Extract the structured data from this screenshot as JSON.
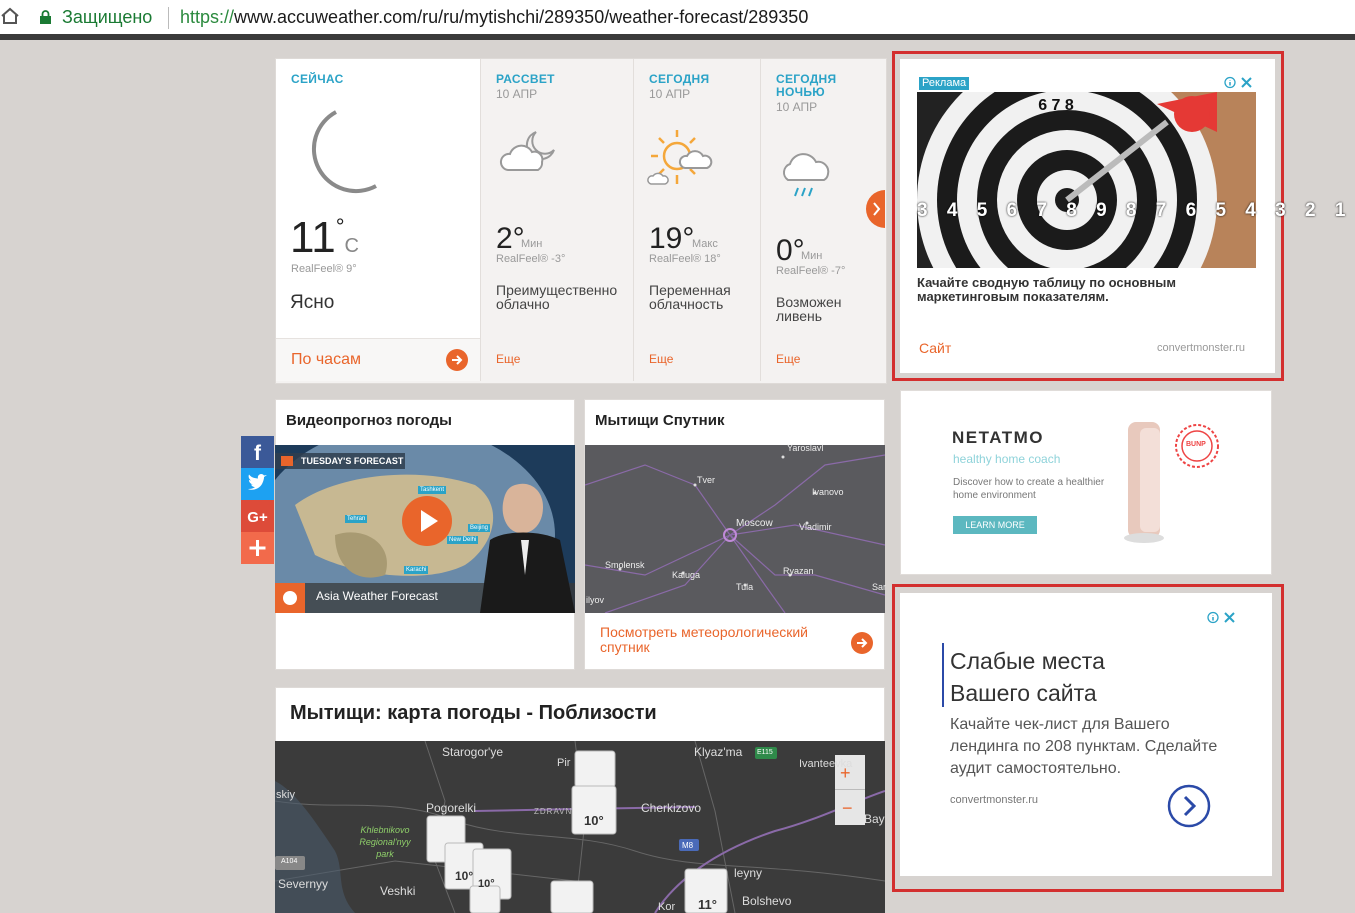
{
  "browser": {
    "secure_label": "Защищено",
    "url_scheme": "https://",
    "url_rest": "www.accuweather.com/ru/ru/mytishchi/289350/weather-forecast/289350"
  },
  "now": {
    "caption": "СЕЙЧАС",
    "temp": "11",
    "deg": "°",
    "unit": "C",
    "realfeel": "RealFeel® 9°",
    "condition": "Ясно",
    "hourly_link": "По часам",
    "icon": "moon-icon"
  },
  "forecasts": [
    {
      "caption": "РАССВЕТ",
      "date": "10 АПР",
      "temp": "2°",
      "tag": "Мин",
      "realfeel": "RealFeel® -3°",
      "condition": "Преимущественно облачно",
      "more": "Еще",
      "icon": "cloud-moon-icon"
    },
    {
      "caption": "СЕГОДНЯ",
      "date": "10 АПР",
      "temp": "19°",
      "tag": "Макс",
      "realfeel": "RealFeel® 18°",
      "condition": "Переменная облачность",
      "more": "Еще",
      "icon": "sun-cloud-icon"
    },
    {
      "caption": "СЕГОДНЯ НОЧЬЮ",
      "date": "10 АПР",
      "temp": "0°",
      "tag": "Мин",
      "realfeel": "RealFeel® -7°",
      "condition": "Возможен ливень",
      "more": "Еще",
      "icon": "rain-cloud-icon"
    }
  ],
  "ad1": {
    "badge": "Реклама",
    "target_numbers": "3 4 5 6 7 8 9 8 7 6 5 4 3 2 1",
    "target_top": "6 7 8",
    "headline": "Качайте сводную таблицу по основным маркетинговым показателям.",
    "cta": "Сайт",
    "domain": "convertmonster.ru"
  },
  "ad2": {
    "brand": "NETATMO",
    "tagline": "healthy home coach",
    "text": "Discover how to create a healthier home environment",
    "button": "LEARN MORE",
    "seal": "BUNP"
  },
  "ad3": {
    "headline": "Слабые места Вашего сайта",
    "text": "Качайте чек-лист для Вашего лендинга по 208 пунктам. Сделайте аудит самостоятельно.",
    "domain": "convertmonster.ru"
  },
  "video": {
    "title": "Видеопрогноз погоды",
    "overlay_banner": "TUESDAY'S FORECAST",
    "caption": "Asia Weather Forecast",
    "map_labels": [
      "Tashkent",
      "Tehran",
      "Beijing",
      "New Delhi",
      "Karachi"
    ]
  },
  "satellite": {
    "title": "Мытищи Спутник",
    "link": "Посмотреть метеорологический спутник",
    "cities": [
      "Yaroslavl",
      "Tver",
      "Ivanovo",
      "Moscow",
      "Vladimir",
      "Smolensk",
      "Kaluga",
      "Tula",
      "Ryazan",
      "Sar",
      "ilyov"
    ]
  },
  "map": {
    "title": "Мытищи: карта погоды - Поблизости",
    "places": [
      "Starogor'ye",
      "Klyaz'ma",
      "Ivanteevka",
      "Pir",
      "Pogorelki",
      "ZDRAVN",
      "Cherkizovo",
      "Khlebnikovo Regional'nyy park",
      "Severnyy",
      "Veshki",
      "Bay",
      "skiy",
      "Bolshevo",
      "leyny",
      "Kor"
    ],
    "temps": [
      "10°",
      "10°",
      "10°",
      "11°"
    ],
    "road_tags": [
      "E115",
      "M8",
      "A104"
    ],
    "zoom_in": "+",
    "zoom_out": "−"
  },
  "social": [
    "facebook",
    "twitter",
    "google-plus",
    "share"
  ],
  "colors": {
    "accent": "#e9652b",
    "caption": "#2ba3c7",
    "ad_frame": "#d32f2f"
  }
}
